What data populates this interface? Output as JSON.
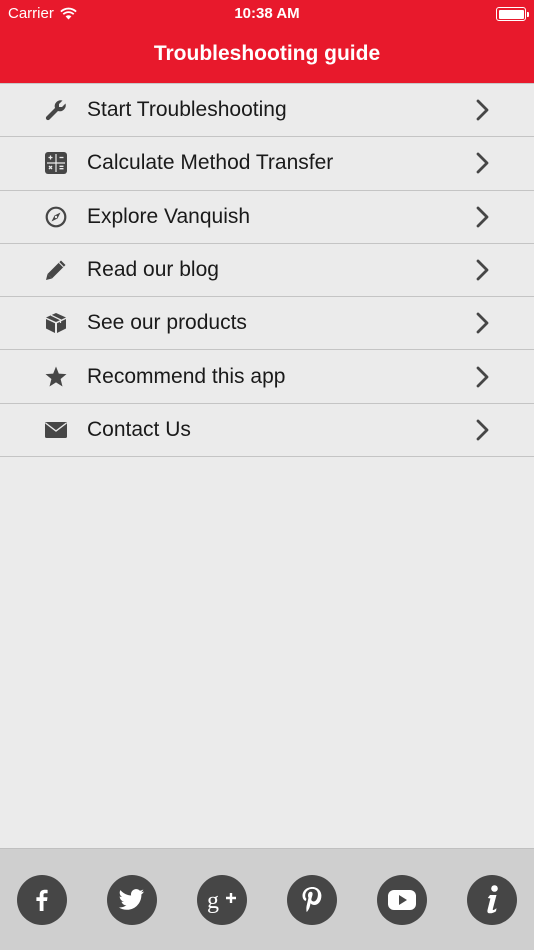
{
  "status_bar": {
    "carrier": "Carrier",
    "time": "10:38 AM"
  },
  "nav": {
    "title": "Troubleshooting guide"
  },
  "menu": {
    "items": [
      {
        "label": "Start Troubleshooting",
        "icon": "wrench-icon"
      },
      {
        "label": "Calculate Method Transfer",
        "icon": "calculator-icon"
      },
      {
        "label": "Explore Vanquish",
        "icon": "compass-icon"
      },
      {
        "label": "Read our blog",
        "icon": "pencil-icon"
      },
      {
        "label": "See our products",
        "icon": "box-icon"
      },
      {
        "label": "Recommend this app",
        "icon": "star-icon"
      },
      {
        "label": "Contact Us",
        "icon": "envelope-icon"
      }
    ]
  },
  "footer": {
    "social": [
      "facebook-icon",
      "twitter-icon",
      "google-plus-icon",
      "pinterest-icon",
      "youtube-icon",
      "info-icon"
    ]
  },
  "colors": {
    "brand_red": "#e8192c",
    "background": "#ebebeb",
    "footer": "#cfcfcf",
    "icon_dark": "#464646"
  }
}
